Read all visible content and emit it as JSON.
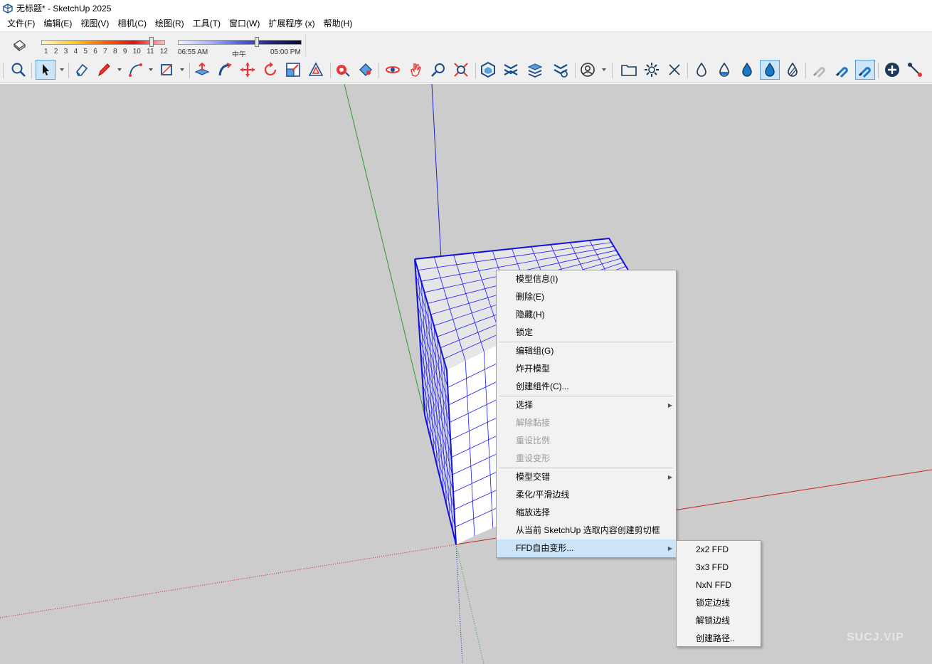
{
  "window": {
    "title": "无标题* - SketchUp 2025"
  },
  "menubar": {
    "items": [
      "文件(F)",
      "编辑(E)",
      "视图(V)",
      "相机(C)",
      "绘图(R)",
      "工具(T)",
      "窗口(W)",
      "扩展程序 (x)",
      "帮助(H)"
    ]
  },
  "shadow_toolbar": {
    "month_ticks": [
      "1",
      "2",
      "3",
      "4",
      "5",
      "6",
      "7",
      "8",
      "9",
      "10",
      "11",
      "12"
    ],
    "month_value": 11,
    "time_start": "06:55 AM",
    "time_mid": "中午",
    "time_end": "05:00 PM",
    "time_value": 0.64
  },
  "tools": {
    "active": "select-tool",
    "accent_color": "#1a66c4",
    "red_color": "#d32020"
  },
  "context_menu": {
    "groups": [
      [
        {
          "label": "模型信息(I)",
          "state": "normal"
        },
        {
          "label": "删除(E)",
          "state": "normal"
        },
        {
          "label": "隐藏(H)",
          "state": "normal"
        },
        {
          "label": "锁定",
          "state": "normal"
        }
      ],
      [
        {
          "label": "编辑组(G)",
          "state": "normal"
        },
        {
          "label": "炸开模型",
          "state": "normal"
        },
        {
          "label": "创建组件(C)...",
          "state": "normal"
        }
      ],
      [
        {
          "label": "选择",
          "state": "normal",
          "submenu": true
        },
        {
          "label": "解除黏接",
          "state": "disabled"
        },
        {
          "label": "重设比例",
          "state": "disabled"
        },
        {
          "label": "重设变形",
          "state": "disabled"
        }
      ],
      [
        {
          "label": "模型交错",
          "state": "normal",
          "submenu": true
        },
        {
          "label": "柔化/平滑边线",
          "state": "normal"
        },
        {
          "label": "缩放选择",
          "state": "normal"
        },
        {
          "label": "从当前 SketchUp 选取内容创建剪切框",
          "state": "normal"
        },
        {
          "label": "FFD自由变形...",
          "state": "highlighted",
          "submenu": true
        }
      ]
    ]
  },
  "submenu": {
    "items": [
      "2x2 FFD",
      "3x3 FFD",
      "NxN FFD",
      "锁定边线",
      "解锁边线",
      "创建路径.."
    ]
  },
  "watermark": "SUCJ.VIP"
}
